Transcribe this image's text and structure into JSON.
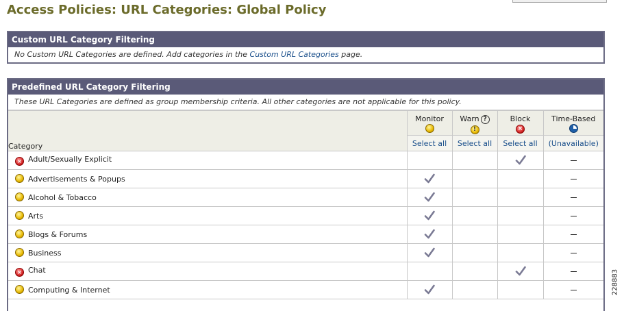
{
  "page": {
    "title": "Access Policies: URL Categories: Global Policy"
  },
  "custom_panel": {
    "header": "Custom URL Category Filtering",
    "note_before": "No Custom URL Categories are defined. Add categories in the ",
    "note_link": "Custom URL Categories",
    "note_after": " page."
  },
  "predefined_panel": {
    "header": "Predefined URL Category Filtering",
    "note": "These URL Categories are defined as group membership criteria. All other categories are not applicable for this policy."
  },
  "table": {
    "category_header": "Category",
    "columns": [
      {
        "key": "monitor",
        "label": "Monitor",
        "icon": "monitor-icon",
        "select": "Select all"
      },
      {
        "key": "warn",
        "label": "Warn",
        "icon": "warn-icon",
        "select": "Select all"
      },
      {
        "key": "block",
        "label": "Block",
        "icon": "block-icon",
        "select": "Select all"
      },
      {
        "key": "time",
        "label": "Time-Based",
        "icon": "time-based-icon",
        "select": "(Unavailable)"
      }
    ],
    "rows": [
      {
        "name": "Adult/Sexually Explicit",
        "icon": "block",
        "action": "block"
      },
      {
        "name": "Advertisements & Popups",
        "icon": "monitor",
        "action": "monitor"
      },
      {
        "name": "Alcohol & Tobacco",
        "icon": "monitor",
        "action": "monitor"
      },
      {
        "name": "Arts",
        "icon": "monitor",
        "action": "monitor"
      },
      {
        "name": "Blogs & Forums",
        "icon": "monitor",
        "action": "monitor"
      },
      {
        "name": "Business",
        "icon": "monitor",
        "action": "monitor"
      },
      {
        "name": "Chat",
        "icon": "block",
        "action": "block"
      },
      {
        "name": "Computing & Internet",
        "icon": "monitor",
        "action": "monitor"
      }
    ]
  },
  "figure_id": "228883",
  "colors": {
    "title": "#6b6b2a",
    "panel_header": "#5a5a78",
    "link": "#1a4f8b",
    "check": "#7a7a94"
  }
}
